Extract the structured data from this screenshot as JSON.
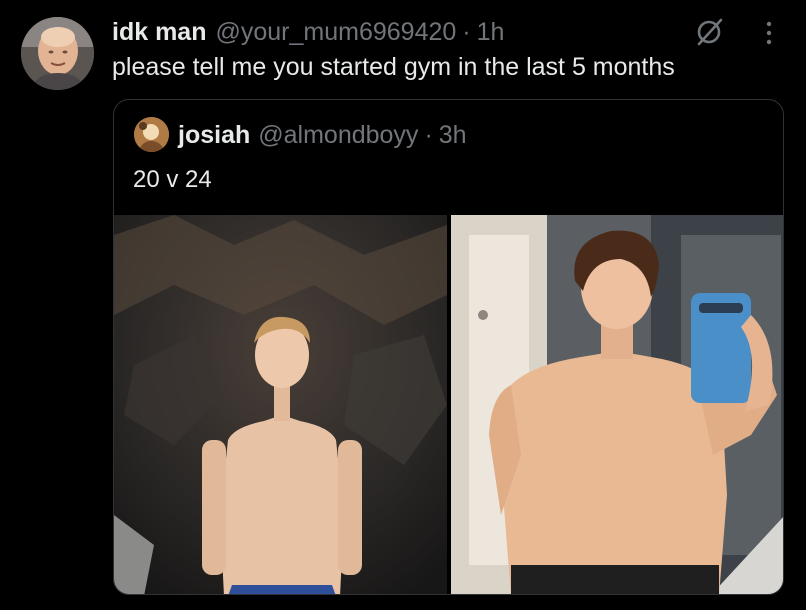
{
  "tweet": {
    "display_name": "idk man",
    "handle": "@your_mum6969420",
    "separator": "·",
    "time": "1h",
    "text": "please tell me you started gym in the last 5 months"
  },
  "quoted_tweet": {
    "display_name": "josiah",
    "handle": "@almondboyy",
    "separator": "·",
    "time": "3h",
    "text": "20 v 24"
  },
  "icons": {
    "grok": "grok-icon",
    "more": "more-options-icon"
  },
  "colors": {
    "background": "#000000",
    "text_primary": "#e7e9ea",
    "text_secondary": "#71767b",
    "border": "#2f3336"
  }
}
